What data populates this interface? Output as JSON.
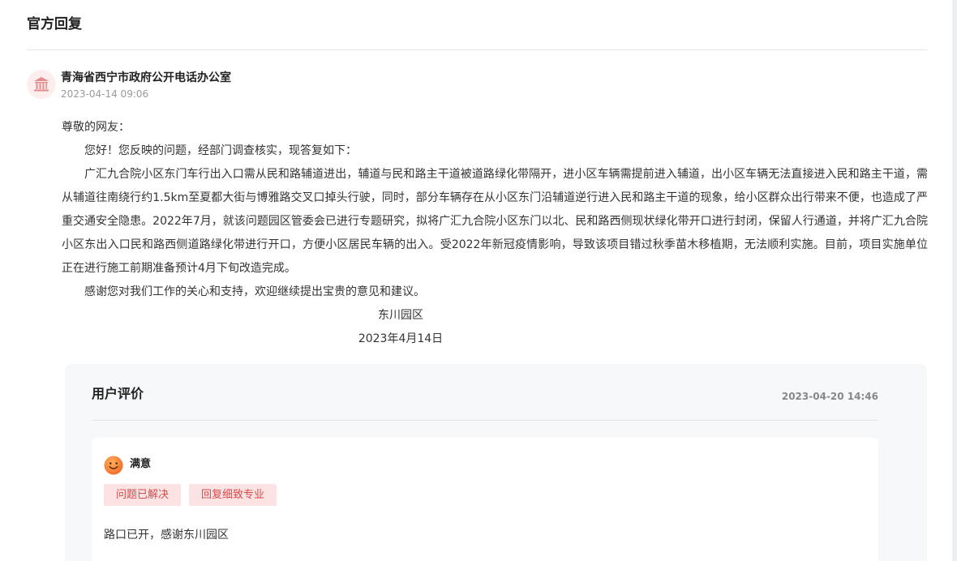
{
  "section": {
    "title": "官方回复"
  },
  "reply": {
    "org_name": "青海省西宁市政府公开电话办公室",
    "time": "2023-04-14 09:06",
    "greeting": "尊敬的网友：",
    "paragraphs": [
      "您好！您反映的问题，经部门调查核实，现答复如下：",
      "广汇九合院小区东门车行出入口需从民和路辅道进出，辅道与民和路主干道被道路绿化带隔开，进小区车辆需提前进入辅道，出小区车辆无法直接进入民和路主干道，需从辅道往南绕行约1.5km至夏都大街与博雅路交叉口掉头行驶，同时，部分车辆存在从小区东门沿辅道逆行进入民和路主干道的现象，给小区群众出行带来不便，也造成了严重交通安全隐患。2022年7月，就该问题园区管委会已进行专题研究，拟将广汇九合院小区东门以北、民和路西侧现状绿化带开口进行封闭，保留人行通道，并将广汇九合院小区东出入口民和路西侧道路绿化带进行开口，方便小区居民车辆的出入。受2022年新冠疫情影响，导致该项目错过秋季苗木移植期，无法顺利实施。目前，项目实施单位正在进行施工前期准备预计4月下旬改造完成。",
      "感谢您对我们工作的关心和支持，欢迎继续提出宝贵的意见和建议。"
    ],
    "signature_org": "东川园区",
    "signature_date": "2023年4月14日"
  },
  "evaluation": {
    "title": "用户评价",
    "time": "2023-04-20 14:46",
    "rating": "满意",
    "tags": [
      "问题已解决",
      "回复细致专业"
    ],
    "comment": "路口已开，感谢东川园区"
  },
  "colors": {
    "accent_red": "#d94a4a",
    "tag_bg": "#fbe3e3",
    "smile": "#f57b2f"
  },
  "icons": {
    "org": "government-building-icon",
    "rating": "smile-face-icon"
  }
}
